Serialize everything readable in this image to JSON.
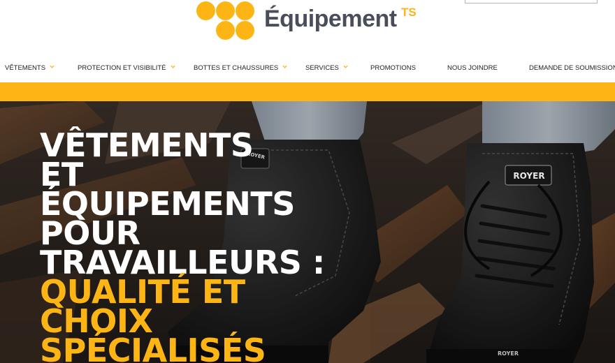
{
  "brand": {
    "name": "Équipement",
    "suffix": "TS",
    "accent_color": "#fdb515",
    "text_color": "#4a4e5a"
  },
  "search": {
    "placeholder": ""
  },
  "nav": {
    "items": [
      {
        "label": "VÊTEMENTS",
        "has_dropdown": true
      },
      {
        "label": "PROTECTION ET VISIBILITÉ",
        "has_dropdown": true
      },
      {
        "label": "BOTTES ET CHAUSSURES",
        "has_dropdown": true
      },
      {
        "label": "SERVICES",
        "has_dropdown": true
      },
      {
        "label": "PROMOTIONS",
        "has_dropdown": false
      },
      {
        "label": "NOUS JOINDRE",
        "has_dropdown": false
      },
      {
        "label": "DEMANDE DE SOUMISSION",
        "has_dropdown": false
      }
    ]
  },
  "hero": {
    "title_white": [
      "VÊTEMENTS",
      "ET",
      "ÉQUIPEMENTS",
      "POUR",
      "TRAVAILLEURS :"
    ],
    "title_yellow": [
      "QUALITÉ ET",
      "CHOIX",
      "SPÉCIALISÉS"
    ],
    "boot_brand": "ROYER",
    "boot_brand_small": "ROYER"
  }
}
